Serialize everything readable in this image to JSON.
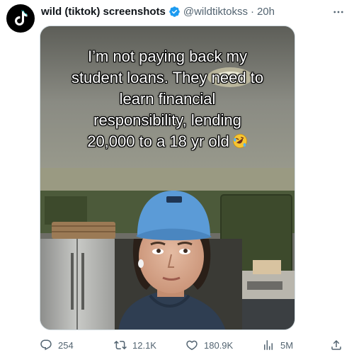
{
  "tweet": {
    "author_name": "wild (tiktok) screenshots",
    "handle": "@wildtiktokss",
    "separator": "·",
    "time": "20h",
    "caption_lines": [
      "I’m not paying back my",
      "student loans. They need to",
      "learn financial",
      "responsibility, lending",
      "20,000 to a 18 yr old"
    ],
    "stats": {
      "replies": "254",
      "retweets": "12.1K",
      "likes": "180.9K",
      "views": "5M"
    }
  },
  "colors": {
    "text_primary": "#0f1419",
    "text_secondary": "#536471",
    "verified": "#1d9bf0",
    "avatar_bg": "#000000"
  },
  "icons": {
    "avatar": "tiktok-logo-icon",
    "verified": "verified-badge-icon",
    "more": "more-icon",
    "reply": "reply-icon",
    "retweet": "retweet-icon",
    "like": "heart-icon",
    "views": "views-icon",
    "share": "share-icon",
    "caption_emoji": "rolling-laughing-emoji-icon"
  }
}
